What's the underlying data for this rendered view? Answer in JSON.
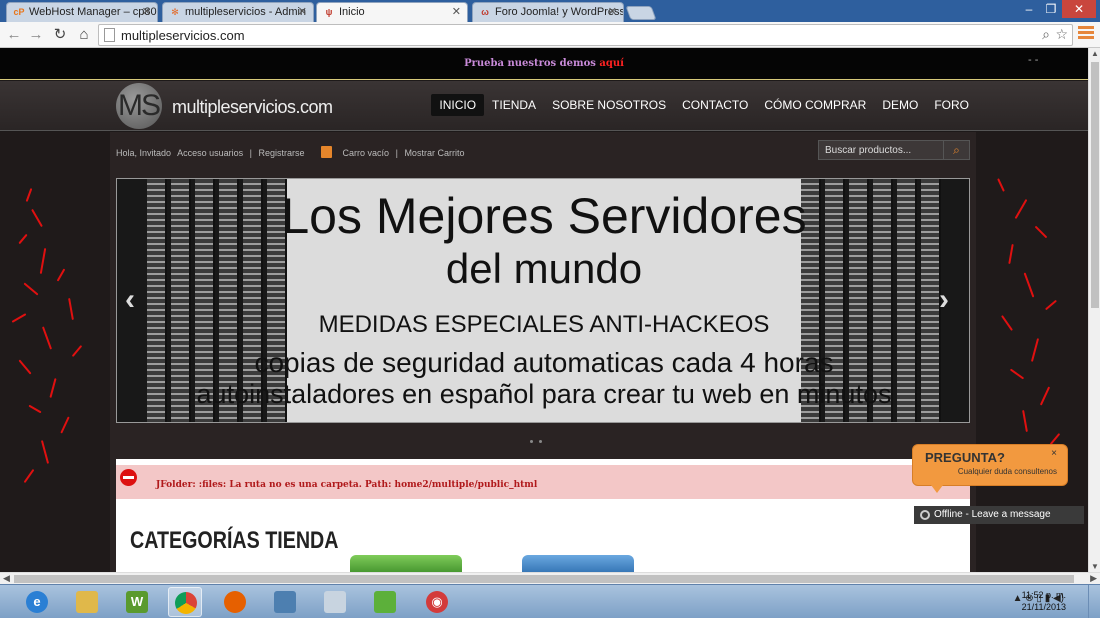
{
  "browser": {
    "tabs": [
      {
        "title": "WebHost Manager – cp80",
        "icon": "cpanel-icon",
        "icon_text": "cP",
        "icon_color": "#e8751a"
      },
      {
        "title": "multipleservicios - Admin",
        "icon": "joomla-icon",
        "icon_text": "✻",
        "icon_color": "#e36b2a"
      },
      {
        "title": "Inicio",
        "icon": "site-icon",
        "icon_text": "ψ",
        "icon_color": "#c0392b",
        "active": true
      },
      {
        "title": "Foro Joomla! y WordPress",
        "icon": "forum-icon",
        "icon_text": "ω",
        "icon_color": "#c0392b"
      }
    ],
    "url": "multipleservicios.com",
    "window_buttons": {
      "minimize": "–",
      "maximize": "❐",
      "close": "✕"
    }
  },
  "site": {
    "promo": {
      "text": "Prueba nuestros demos ",
      "highlight": "aquí"
    },
    "topbar_dash": "- -",
    "logo": {
      "monogram": "MS",
      "name": "multipleservicios.com"
    },
    "nav": [
      "INICIO",
      "TIENDA",
      "SOBRE NOSOTROS",
      "CONTACTO",
      "CÓMO COMPRAR",
      "DEMO",
      "FORO"
    ],
    "userbar": {
      "greeting": "Hola, Invitado",
      "login": "Acceso usuarios",
      "sep": "|",
      "register": "Registrarse",
      "cart": "Carro vacío",
      "show_cart": "Mostrar Carrito"
    },
    "search": {
      "placeholder": "Buscar productos..."
    },
    "banner": {
      "line1": "Los Mejores Servidores",
      "line2": "del mundo",
      "line3": "MEDIDAS ESPECIALES ANTI-HACKEOS",
      "line4": "copias de seguridad automaticas cada 4 horas",
      "line5": "autoinstaladores en español para crear tu web en minutos"
    },
    "error": "JFolder: :files: La ruta no es una carpeta. Path: home2/multiple/public_html",
    "categories_title": "CATEGORÍAS TIENDA"
  },
  "chat": {
    "title": "PREGUNTA?",
    "subtitle": "Cualquier duda consultenos",
    "close": "×",
    "status": "Offline - Leave a message"
  },
  "taskbar": {
    "apps": [
      "ie-icon",
      "explorer-icon",
      "wamp-icon",
      "chrome-icon",
      "firefox-icon",
      "network-icon",
      "calculator-icon",
      "notepad-icon",
      "camera-icon"
    ],
    "clock": {
      "time": "11:52 p. m.",
      "date": "21/11/2013"
    }
  }
}
